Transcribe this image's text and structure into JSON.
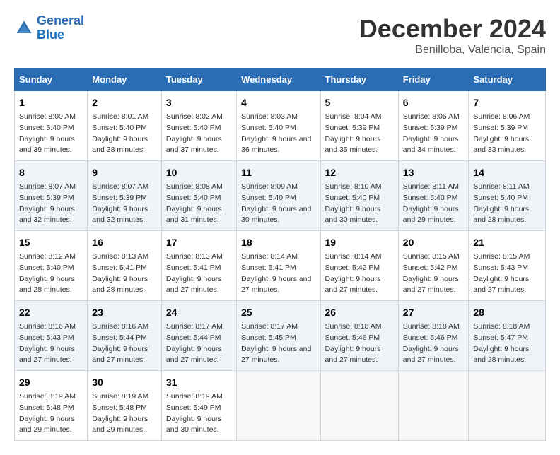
{
  "logo": {
    "line1": "General",
    "line2": "Blue"
  },
  "title": "December 2024",
  "subtitle": "Benilloba, Valencia, Spain",
  "header": {
    "accent_color": "#2a6db5"
  },
  "days_of_week": [
    "Sunday",
    "Monday",
    "Tuesday",
    "Wednesday",
    "Thursday",
    "Friday",
    "Saturday"
  ],
  "weeks": [
    [
      {
        "day": "1",
        "sunrise": "Sunrise: 8:00 AM",
        "sunset": "Sunset: 5:40 PM",
        "daylight": "Daylight: 9 hours and 39 minutes."
      },
      {
        "day": "2",
        "sunrise": "Sunrise: 8:01 AM",
        "sunset": "Sunset: 5:40 PM",
        "daylight": "Daylight: 9 hours and 38 minutes."
      },
      {
        "day": "3",
        "sunrise": "Sunrise: 8:02 AM",
        "sunset": "Sunset: 5:40 PM",
        "daylight": "Daylight: 9 hours and 37 minutes."
      },
      {
        "day": "4",
        "sunrise": "Sunrise: 8:03 AM",
        "sunset": "Sunset: 5:40 PM",
        "daylight": "Daylight: 9 hours and 36 minutes."
      },
      {
        "day": "5",
        "sunrise": "Sunrise: 8:04 AM",
        "sunset": "Sunset: 5:39 PM",
        "daylight": "Daylight: 9 hours and 35 minutes."
      },
      {
        "day": "6",
        "sunrise": "Sunrise: 8:05 AM",
        "sunset": "Sunset: 5:39 PM",
        "daylight": "Daylight: 9 hours and 34 minutes."
      },
      {
        "day": "7",
        "sunrise": "Sunrise: 8:06 AM",
        "sunset": "Sunset: 5:39 PM",
        "daylight": "Daylight: 9 hours and 33 minutes."
      }
    ],
    [
      {
        "day": "8",
        "sunrise": "Sunrise: 8:07 AM",
        "sunset": "Sunset: 5:39 PM",
        "daylight": "Daylight: 9 hours and 32 minutes."
      },
      {
        "day": "9",
        "sunrise": "Sunrise: 8:07 AM",
        "sunset": "Sunset: 5:39 PM",
        "daylight": "Daylight: 9 hours and 32 minutes."
      },
      {
        "day": "10",
        "sunrise": "Sunrise: 8:08 AM",
        "sunset": "Sunset: 5:40 PM",
        "daylight": "Daylight: 9 hours and 31 minutes."
      },
      {
        "day": "11",
        "sunrise": "Sunrise: 8:09 AM",
        "sunset": "Sunset: 5:40 PM",
        "daylight": "Daylight: 9 hours and 30 minutes."
      },
      {
        "day": "12",
        "sunrise": "Sunrise: 8:10 AM",
        "sunset": "Sunset: 5:40 PM",
        "daylight": "Daylight: 9 hours and 30 minutes."
      },
      {
        "day": "13",
        "sunrise": "Sunrise: 8:11 AM",
        "sunset": "Sunset: 5:40 PM",
        "daylight": "Daylight: 9 hours and 29 minutes."
      },
      {
        "day": "14",
        "sunrise": "Sunrise: 8:11 AM",
        "sunset": "Sunset: 5:40 PM",
        "daylight": "Daylight: 9 hours and 28 minutes."
      }
    ],
    [
      {
        "day": "15",
        "sunrise": "Sunrise: 8:12 AM",
        "sunset": "Sunset: 5:40 PM",
        "daylight": "Daylight: 9 hours and 28 minutes."
      },
      {
        "day": "16",
        "sunrise": "Sunrise: 8:13 AM",
        "sunset": "Sunset: 5:41 PM",
        "daylight": "Daylight: 9 hours and 28 minutes."
      },
      {
        "day": "17",
        "sunrise": "Sunrise: 8:13 AM",
        "sunset": "Sunset: 5:41 PM",
        "daylight": "Daylight: 9 hours and 27 minutes."
      },
      {
        "day": "18",
        "sunrise": "Sunrise: 8:14 AM",
        "sunset": "Sunset: 5:41 PM",
        "daylight": "Daylight: 9 hours and 27 minutes."
      },
      {
        "day": "19",
        "sunrise": "Sunrise: 8:14 AM",
        "sunset": "Sunset: 5:42 PM",
        "daylight": "Daylight: 9 hours and 27 minutes."
      },
      {
        "day": "20",
        "sunrise": "Sunrise: 8:15 AM",
        "sunset": "Sunset: 5:42 PM",
        "daylight": "Daylight: 9 hours and 27 minutes."
      },
      {
        "day": "21",
        "sunrise": "Sunrise: 8:15 AM",
        "sunset": "Sunset: 5:43 PM",
        "daylight": "Daylight: 9 hours and 27 minutes."
      }
    ],
    [
      {
        "day": "22",
        "sunrise": "Sunrise: 8:16 AM",
        "sunset": "Sunset: 5:43 PM",
        "daylight": "Daylight: 9 hours and 27 minutes."
      },
      {
        "day": "23",
        "sunrise": "Sunrise: 8:16 AM",
        "sunset": "Sunset: 5:44 PM",
        "daylight": "Daylight: 9 hours and 27 minutes."
      },
      {
        "day": "24",
        "sunrise": "Sunrise: 8:17 AM",
        "sunset": "Sunset: 5:44 PM",
        "daylight": "Daylight: 9 hours and 27 minutes."
      },
      {
        "day": "25",
        "sunrise": "Sunrise: 8:17 AM",
        "sunset": "Sunset: 5:45 PM",
        "daylight": "Daylight: 9 hours and 27 minutes."
      },
      {
        "day": "26",
        "sunrise": "Sunrise: 8:18 AM",
        "sunset": "Sunset: 5:46 PM",
        "daylight": "Daylight: 9 hours and 27 minutes."
      },
      {
        "day": "27",
        "sunrise": "Sunrise: 8:18 AM",
        "sunset": "Sunset: 5:46 PM",
        "daylight": "Daylight: 9 hours and 27 minutes."
      },
      {
        "day": "28",
        "sunrise": "Sunrise: 8:18 AM",
        "sunset": "Sunset: 5:47 PM",
        "daylight": "Daylight: 9 hours and 28 minutes."
      }
    ],
    [
      {
        "day": "29",
        "sunrise": "Sunrise: 8:19 AM",
        "sunset": "Sunset: 5:48 PM",
        "daylight": "Daylight: 9 hours and 29 minutes."
      },
      {
        "day": "30",
        "sunrise": "Sunrise: 8:19 AM",
        "sunset": "Sunset: 5:48 PM",
        "daylight": "Daylight: 9 hours and 29 minutes."
      },
      {
        "day": "31",
        "sunrise": "Sunrise: 8:19 AM",
        "sunset": "Sunset: 5:49 PM",
        "daylight": "Daylight: 9 hours and 30 minutes."
      },
      null,
      null,
      null,
      null
    ]
  ]
}
